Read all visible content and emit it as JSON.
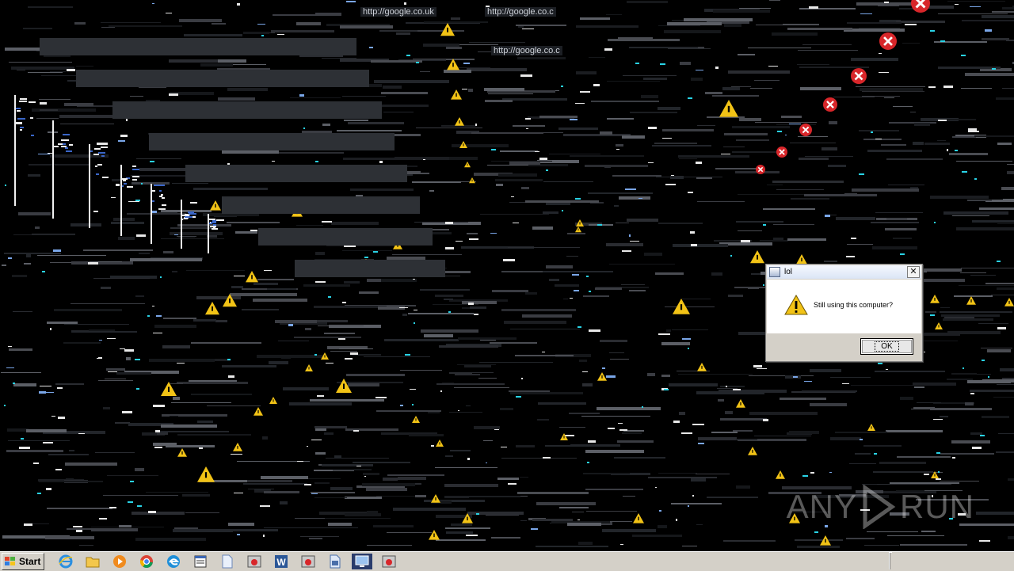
{
  "browser_ghosts": {
    "url_1": "http://google.co.uk",
    "url_2": "http://google.co.c",
    "url_3": "http://google.co.c"
  },
  "dialog": {
    "title": "lol",
    "message": "Still using this computer?",
    "ok_label": "OK",
    "close_label": "✕"
  },
  "watermark": {
    "left": "ANY",
    "right": "RUN"
  },
  "taskbar": {
    "start_label": "Start",
    "items": [
      {
        "name": "internet-explorer-icon"
      },
      {
        "name": "file-explorer-icon"
      },
      {
        "name": "media-player-icon"
      },
      {
        "name": "chrome-icon"
      },
      {
        "name": "edge-icon"
      },
      {
        "name": "notepad-window-icon"
      },
      {
        "name": "document-icon"
      },
      {
        "name": "error-app-icon"
      },
      {
        "name": "word-icon"
      },
      {
        "name": "error-app-icon-2"
      },
      {
        "name": "file-icon"
      },
      {
        "name": "monitor-app-icon"
      },
      {
        "name": "error-app-icon-3"
      }
    ]
  },
  "colors": {
    "warning_yellow": "#f2c316",
    "error_red": "#d8262a",
    "accent_cyan": "#29d3e6",
    "dialog_face": "#d4d0c8"
  }
}
